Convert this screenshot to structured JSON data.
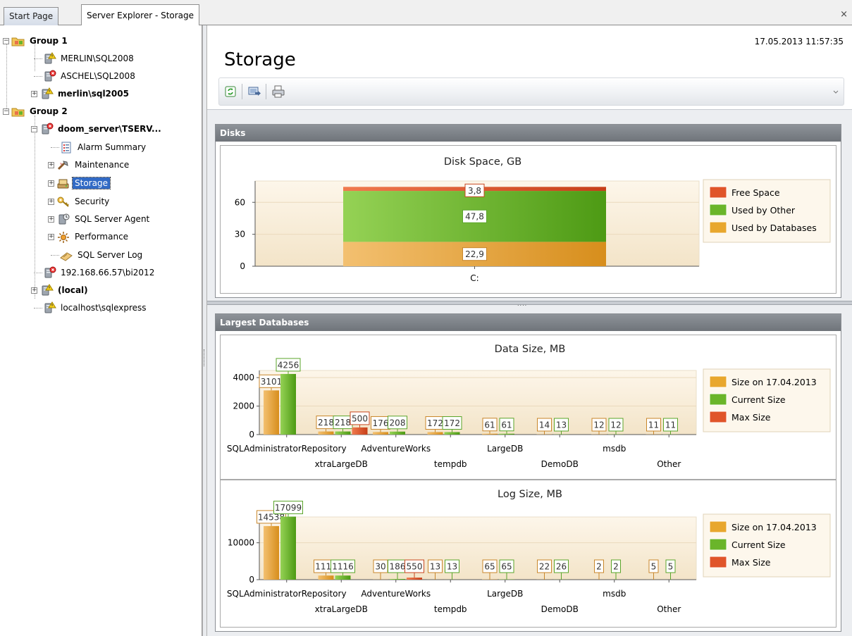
{
  "tabs": [
    {
      "label": "Start Page",
      "active": false
    },
    {
      "label": "Server Explorer - Storage",
      "active": true
    }
  ],
  "tabstrip": {
    "close_glyph": "×"
  },
  "tree": {
    "nodes": [
      {
        "label": "Group 1",
        "icon": "folder-group-icon",
        "bold": true
      },
      {
        "label": "MERLIN\\SQL2008",
        "icon": "server-warning-icon",
        "bold": false
      },
      {
        "label": "ASCHEL\\SQL2008",
        "icon": "server-error-icon",
        "bold": false
      },
      {
        "label": "merlin\\sql2005",
        "icon": "server-warning-icon",
        "bold": true
      },
      {
        "label": "Group 2",
        "icon": "folder-group-icon",
        "bold": true
      },
      {
        "label": "doom_server\\TSERV...",
        "icon": "server-error-icon",
        "bold": true
      },
      {
        "label": "Alarm Summary",
        "icon": "alarm-summary-icon",
        "bold": false
      },
      {
        "label": "Maintenance",
        "icon": "maintenance-icon",
        "bold": false
      },
      {
        "label": "Storage",
        "icon": "storage-icon",
        "bold": false,
        "selected": true
      },
      {
        "label": "Security",
        "icon": "security-key-icon",
        "bold": false
      },
      {
        "label": "SQL Server Agent",
        "icon": "agent-icon",
        "bold": false
      },
      {
        "label": "Performance",
        "icon": "performance-icon",
        "bold": false
      },
      {
        "label": "SQL Server Log",
        "icon": "log-icon",
        "bold": false
      },
      {
        "label": "192.168.66.57\\bi2012",
        "icon": "server-error-icon",
        "bold": false
      },
      {
        "label": "(local)",
        "icon": "server-warning-icon",
        "bold": true
      },
      {
        "label": "localhost\\sqlexpress",
        "icon": "server-warning-icon",
        "bold": false
      }
    ]
  },
  "header": {
    "title": "Storage",
    "timestamp": "17.05.2013 11:57:35"
  },
  "toolbar": {
    "buttons": [
      "refresh-icon",
      "export-icon",
      "print-icon"
    ]
  },
  "panels": {
    "disks_title": "Disks",
    "largest_title": "Largest Databases"
  },
  "colors": {
    "free": "#e0552a",
    "used_other": "#6ab52a",
    "used_db": "#e8a72e",
    "selection": "#316ac5"
  },
  "chart_data": [
    {
      "type": "bar",
      "stacked": true,
      "title": "Disk Space, GB",
      "categories": [
        "C:"
      ],
      "ylim": [
        0,
        80
      ],
      "yticks": [
        0,
        30,
        60
      ],
      "legend_position": "right",
      "series": [
        {
          "name": "Used by Databases",
          "values": [
            22.9
          ],
          "labels": [
            "22,9"
          ]
        },
        {
          "name": "Used by Other",
          "values": [
            47.8
          ],
          "labels": [
            "47,8"
          ]
        },
        {
          "name": "Free Space",
          "values": [
            3.8
          ],
          "labels": [
            "3,8"
          ]
        }
      ],
      "legend_order": [
        "Free Space",
        "Used by Other",
        "Used by Databases"
      ]
    },
    {
      "type": "bar",
      "title": "Data Size, MB",
      "categories": [
        "SQLAdministratorRepository",
        "xtraLargeDB",
        "AdventureWorks",
        "tempdb",
        "LargeDB",
        "DemoDB",
        "msdb",
        "Other"
      ],
      "ylim": [
        0,
        4500
      ],
      "yticks": [
        0,
        2000,
        4000
      ],
      "legend_position": "right",
      "series": [
        {
          "name": "Size on 17.04.2013",
          "values": [
            3101,
            218,
            176,
            172,
            61,
            14,
            12,
            11
          ]
        },
        {
          "name": "Current Size",
          "values": [
            4256,
            218,
            208,
            172,
            61,
            13,
            12,
            11
          ]
        },
        {
          "name": "Max Size",
          "values": [
            null,
            500,
            null,
            null,
            null,
            null,
            null,
            null
          ]
        }
      ]
    },
    {
      "type": "bar",
      "title": "Log Size, MB",
      "categories": [
        "SQLAdministratorRepository",
        "xtraLargeDB",
        "AdventureWorks",
        "tempdb",
        "LargeDB",
        "DemoDB",
        "msdb",
        "Other"
      ],
      "ylim": [
        0,
        17000
      ],
      "yticks": [
        0,
        10000
      ],
      "legend_position": "right",
      "series": [
        {
          "name": "Size on 17.04.2013",
          "values": [
            14538,
            1116,
            30,
            13,
            65,
            22,
            2,
            5
          ]
        },
        {
          "name": "Current Size",
          "values": [
            17099,
            1116,
            186,
            13,
            65,
            26,
            2,
            5
          ]
        },
        {
          "name": "Max Size",
          "values": [
            null,
            null,
            550,
            null,
            null,
            null,
            null,
            null
          ]
        }
      ]
    }
  ]
}
